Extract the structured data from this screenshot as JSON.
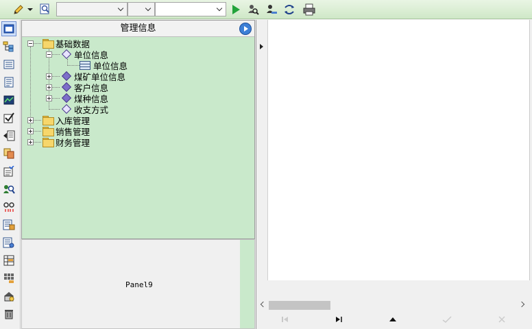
{
  "toolbar": {
    "icons": [
      "pencil-icon",
      "dropdown-arrow-icon",
      "find-icon",
      "play-icon",
      "search-user-icon",
      "search-user-alt-icon",
      "refresh-icon",
      "print-icon"
    ],
    "combo1": {
      "value": ""
    },
    "combo2": {
      "value": ""
    },
    "combo3": {
      "value": ""
    },
    "accent": "#22a33a"
  },
  "iconbar": {
    "icons": [
      "window-icon",
      "tree-icon",
      "list-icon",
      "document-icon",
      "chart-icon",
      "checkbox-icon",
      "export-icon",
      "copy-icon",
      "checklist-icon",
      "search-people-icon",
      "link-icon",
      "report-icon",
      "report-alt-icon",
      "grid-report-icon",
      "module-icon",
      "settings-icon",
      "trash-icon"
    ]
  },
  "tree": {
    "title": "管理信息",
    "nodes": {
      "basic": "基础数据",
      "unit_info": "单位信息",
      "unit_info_child": "单位信息",
      "mine_unit": "煤矿单位信息",
      "customer": "客户信息",
      "coal_type": "煤种信息",
      "payment": "收支方式",
      "inbound": "入库管理",
      "sales": "销售管理",
      "finance": "财务管理"
    },
    "bg_color": "#c9e9cb"
  },
  "panel9": {
    "label": "Panel9"
  },
  "grid": {
    "navigator": [
      "first-icon",
      "last-icon",
      "up-icon",
      "post-icon",
      "cancel-icon"
    ]
  }
}
